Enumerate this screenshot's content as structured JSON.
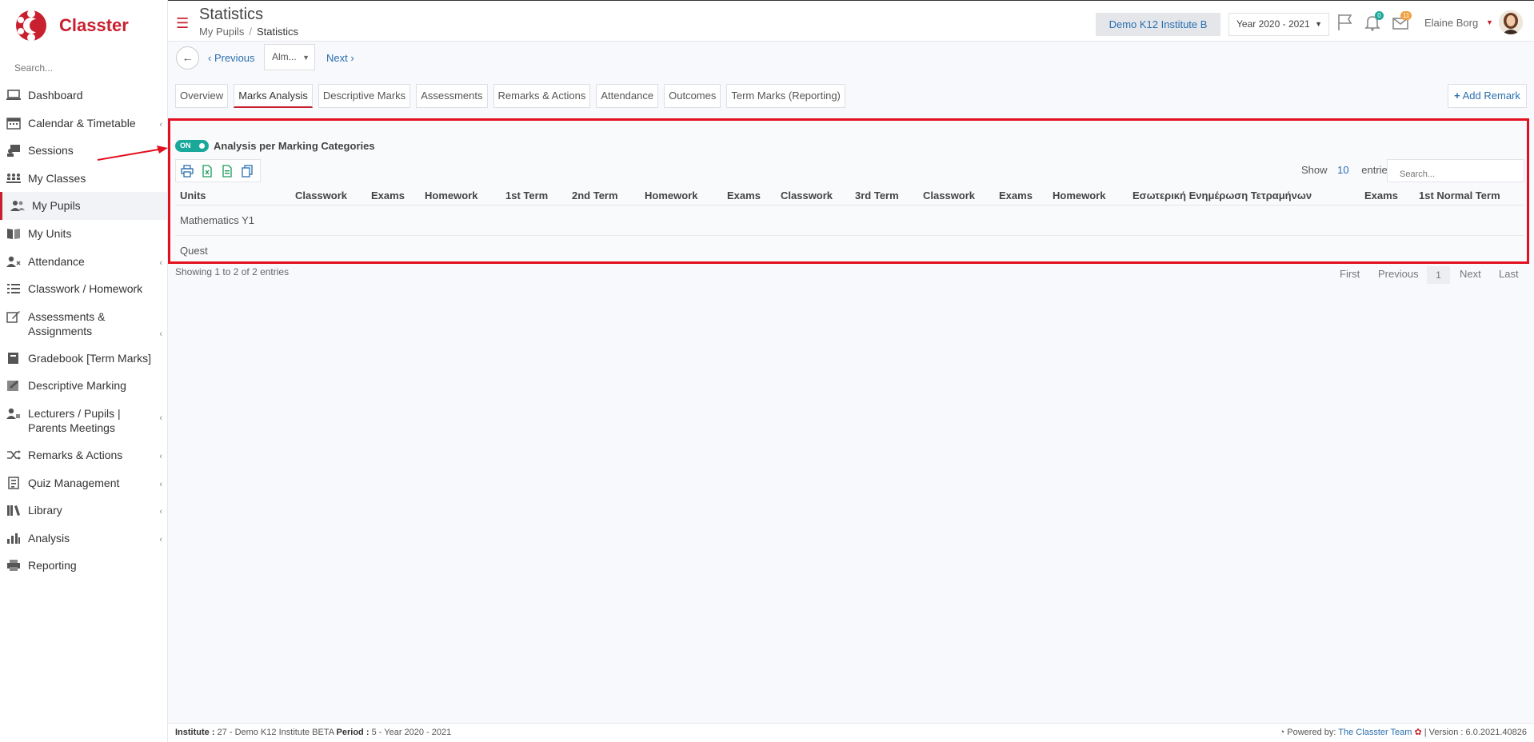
{
  "brand": {
    "name": "Classter"
  },
  "sidebar": {
    "search_placeholder": "Search...",
    "items": [
      {
        "label": "Dashboard",
        "icon": "laptop-icon",
        "chevron": false
      },
      {
        "label": "Calendar & Timetable",
        "icon": "calendar-icon",
        "chevron": true
      },
      {
        "label": "Sessions",
        "icon": "sessions-icon",
        "chevron": false
      },
      {
        "label": "My Classes",
        "icon": "classes-icon",
        "chevron": false
      },
      {
        "label": "My Pupils",
        "icon": "pupils-icon",
        "chevron": false,
        "active": true
      },
      {
        "label": "My Units",
        "icon": "book-icon",
        "chevron": false
      },
      {
        "label": "Attendance",
        "icon": "attendance-icon",
        "chevron": true
      },
      {
        "label": "Classwork / Homework",
        "icon": "list-icon",
        "chevron": false
      },
      {
        "label": "Assessments & Assignments",
        "icon": "edit-icon",
        "chevron": true
      },
      {
        "label": "Gradebook [Term Marks]",
        "icon": "gradebook-icon",
        "chevron": false
      },
      {
        "label": "Descriptive Marking",
        "icon": "marking-icon",
        "chevron": false
      },
      {
        "label": "Lecturers / Pupils | Parents Meetings",
        "icon": "meetings-icon",
        "chevron": true
      },
      {
        "label": "Remarks & Actions",
        "icon": "shuffle-icon",
        "chevron": true
      },
      {
        "label": "Quiz Management",
        "icon": "quiz-icon",
        "chevron": true
      },
      {
        "label": "Library",
        "icon": "library-icon",
        "chevron": true
      },
      {
        "label": "Analysis",
        "icon": "chart-icon",
        "chevron": true
      },
      {
        "label": "Reporting",
        "icon": "printer-icon",
        "chevron": false
      }
    ]
  },
  "header": {
    "title": "Statistics",
    "breadcrumb": [
      "My Pupils",
      "Statistics"
    ],
    "institute_button": "Demo K12 Institute B",
    "year_select": "Year 2020 - 2021",
    "notifications_count": "0",
    "messages_count": "11",
    "user_name": "Elaine Borg"
  },
  "nav": {
    "previous": "Previous",
    "select_value": "Alm...",
    "next": "Next"
  },
  "tabs": [
    {
      "label": "Overview"
    },
    {
      "label": "Marks Analysis",
      "active": true
    },
    {
      "label": "Descriptive Marks"
    },
    {
      "label": "Assessments"
    },
    {
      "label": "Remarks & Actions"
    },
    {
      "label": "Attendance"
    },
    {
      "label": "Outcomes"
    },
    {
      "label": "Term Marks (Reporting)"
    }
  ],
  "add_remark": "Add Remark",
  "panel": {
    "toggle_state": "ON",
    "toggle_label": "Analysis per Marking Categories",
    "show_label": "Show",
    "show_count": "10",
    "entries_label": "entries",
    "search_placeholder": "Search...",
    "columns": [
      "Units",
      "Classwork",
      "Exams",
      "Homework",
      "1st Term",
      "2nd Term",
      "Homework",
      "Exams",
      "Classwork",
      "3rd Term",
      "Classwork",
      "Exams",
      "Homework",
      "Εσωτερική Ενημέρωση Τετραμήνων",
      "Exams",
      "1st Normal Term"
    ],
    "rows": [
      {
        "unit": "Mathematics Y1"
      },
      {
        "unit": "Quest"
      }
    ]
  },
  "pagination": {
    "info": "Showing 1 to 2 of 2 entries",
    "first": "First",
    "previous": "Previous",
    "current": "1",
    "next": "Next",
    "last": "Last"
  },
  "footer": {
    "institute_label": "Institute :",
    "institute_value": "27 - Demo K12 Institute BETA",
    "period_label": "Period :",
    "period_value": "5 - Year 2020 - 2021",
    "powered_by": "Powered by:",
    "team": "The Classter Team",
    "version": "| Version : 6.0.2021.40826"
  },
  "colors": {
    "brand_red": "#c8202f",
    "link_blue": "#2a6fb0",
    "toggle_teal": "#1aa89b",
    "highlight_red": "#e3101f"
  }
}
